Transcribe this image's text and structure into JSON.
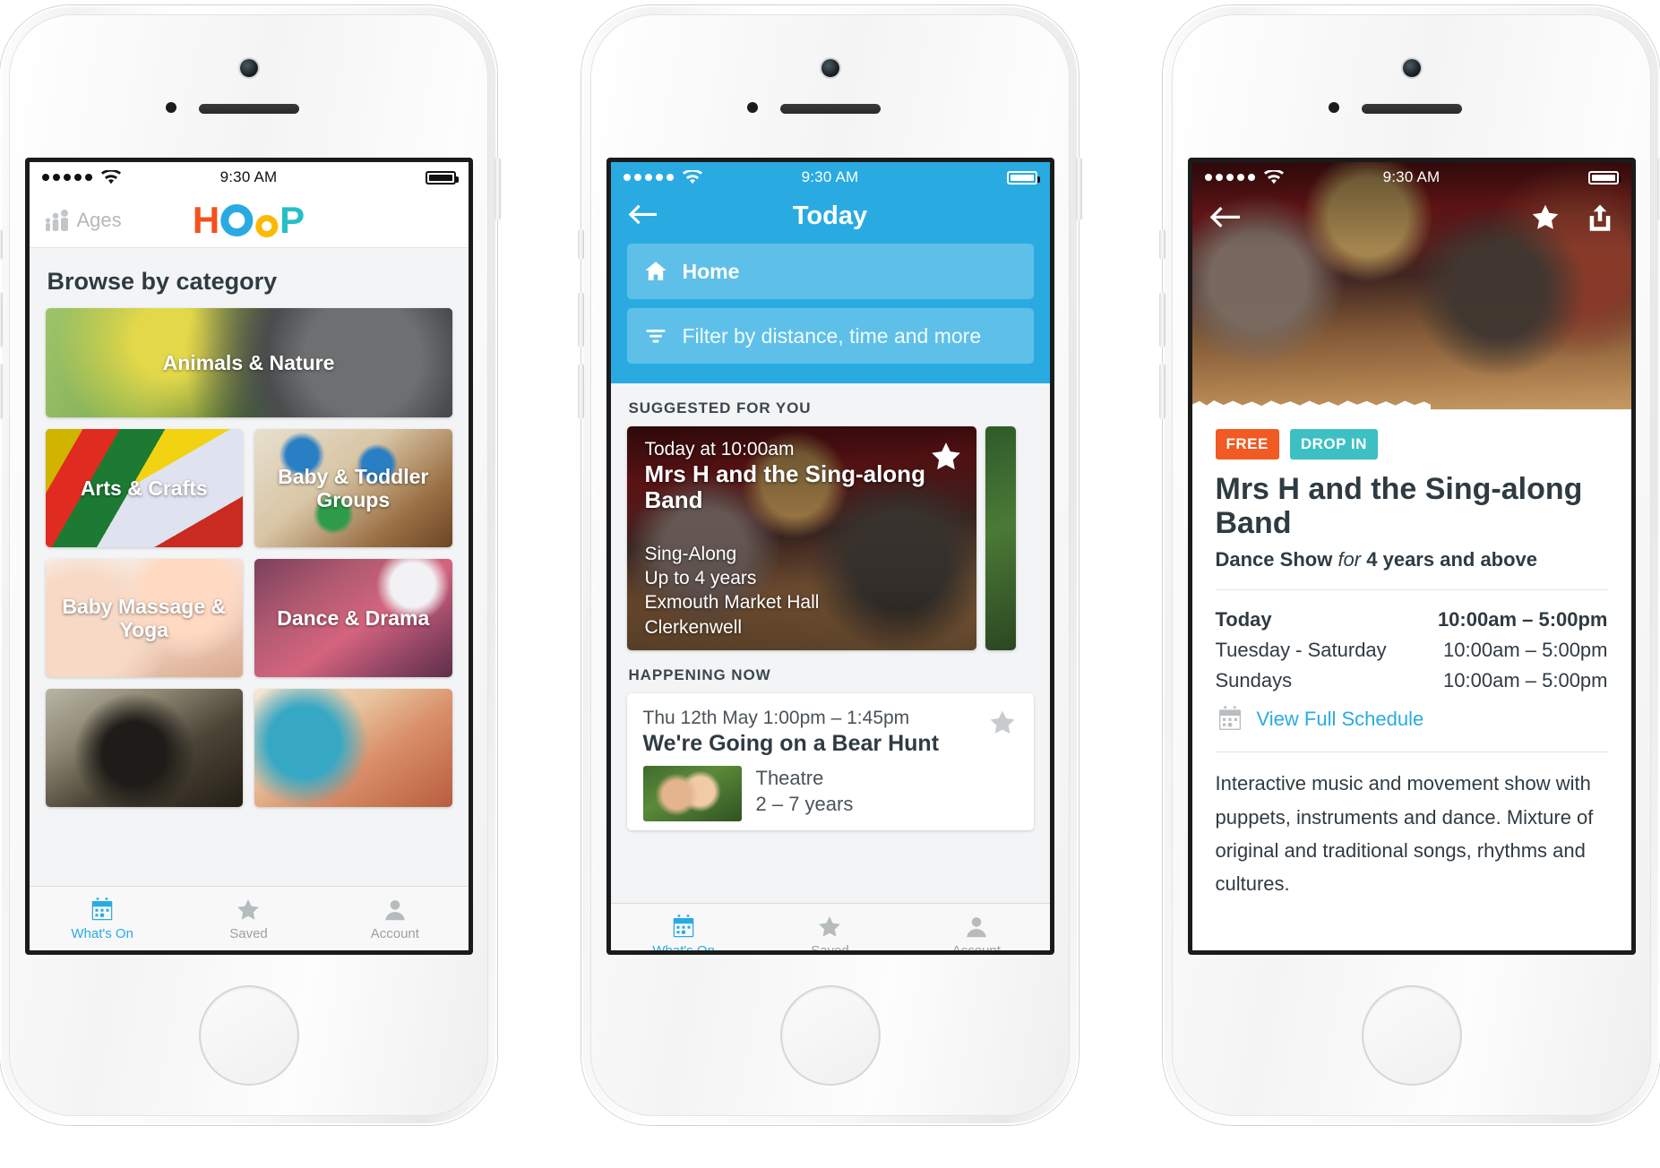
{
  "status_bar": {
    "time": "9:30 AM",
    "signal_dots": 5,
    "wifi": "wifi-icon",
    "battery": "battery-full-icon"
  },
  "phone1": {
    "nav": {
      "ages_label": "Ages",
      "ages_icon": "family-ages-icon",
      "logo": {
        "h": "H",
        "o_big": "O",
        "o_small": "o",
        "p": "P"
      }
    },
    "heading": "Browse by category",
    "categories": [
      {
        "label": "Animals & Nature",
        "size": "wide"
      },
      {
        "label": "Arts & Crafts",
        "size": "half"
      },
      {
        "label": "Baby & Toddler Groups",
        "size": "half"
      },
      {
        "label": "Baby Massage & Yoga",
        "size": "half"
      },
      {
        "label": "Dance & Drama",
        "size": "half"
      },
      {
        "label": "",
        "size": "half"
      },
      {
        "label": "",
        "size": "half"
      }
    ],
    "tabs": [
      {
        "label": "What's On",
        "icon": "calendar-icon",
        "active": true
      },
      {
        "label": "Saved",
        "icon": "star-icon",
        "active": false
      },
      {
        "label": "Account",
        "icon": "person-icon",
        "active": false
      }
    ]
  },
  "phone2": {
    "nav": {
      "back_icon": "back-arrow-icon",
      "title": "Today"
    },
    "location_pill": {
      "icon": "home-icon",
      "label": "Home"
    },
    "filter_pill": {
      "icon": "filter-icon",
      "label": "Filter by distance, time and more"
    },
    "suggested": {
      "section_title": "SUGGESTED FOR YOU",
      "card": {
        "when": "Today at 10:00am",
        "name": "Mrs H and the Sing-along Band",
        "category": "Sing-Along",
        "ages": "Up to 4 years",
        "venue": "Exmouth Market Hall",
        "area": "Clerkenwell",
        "save_icon": "star-icon"
      }
    },
    "happening_now": {
      "section_title": "HAPPENING NOW",
      "card": {
        "when": "Thu 12th May 1:00pm – 1:45pm",
        "name": "We're Going on a Bear Hunt",
        "category": "Theatre",
        "ages": "2 – 7 years",
        "save_icon": "star-icon"
      }
    },
    "tabs": [
      {
        "label": "What's On",
        "icon": "calendar-icon",
        "active": true
      },
      {
        "label": "Saved",
        "icon": "star-icon",
        "active": false
      },
      {
        "label": "Account",
        "icon": "person-icon",
        "active": false
      }
    ]
  },
  "phone3": {
    "hero": {
      "back_icon": "back-arrow-icon",
      "save_icon": "star-icon",
      "share_icon": "share-icon"
    },
    "badges": [
      {
        "label": "FREE",
        "color": "#F15A22"
      },
      {
        "label": "DROP IN",
        "color": "#3CC0C4"
      }
    ],
    "title": "Mrs H and the Sing-along Band",
    "subtitle": {
      "type": "Dance Show",
      "connector": "for",
      "ages": "4 years and above"
    },
    "schedule": [
      {
        "day": "Today",
        "time": "10:00am – 5:00pm",
        "bold": true
      },
      {
        "day": "Tuesday - Saturday",
        "time": "10:00am – 5:00pm",
        "bold": false
      },
      {
        "day": "Sundays",
        "time": "10:00am – 5:00pm",
        "bold": false
      }
    ],
    "schedule_link": {
      "icon": "calendar-icon",
      "label": "View Full Schedule"
    },
    "description": "Interactive music and movement show with puppets, instruments and dance. Mixture of original and traditional songs, rhythms and cultures."
  },
  "colors": {
    "brand_blue": "#29ABE2",
    "orange": "#F15A22",
    "teal": "#3CC0C4",
    "logo_h": "#F4511E",
    "logo_o": "#29ABE2",
    "logo_small_o": "#FBBA00",
    "logo_p": "#26BFC7",
    "text_dark": "#2f3b43",
    "bg_grey": "#f3f4f5"
  }
}
